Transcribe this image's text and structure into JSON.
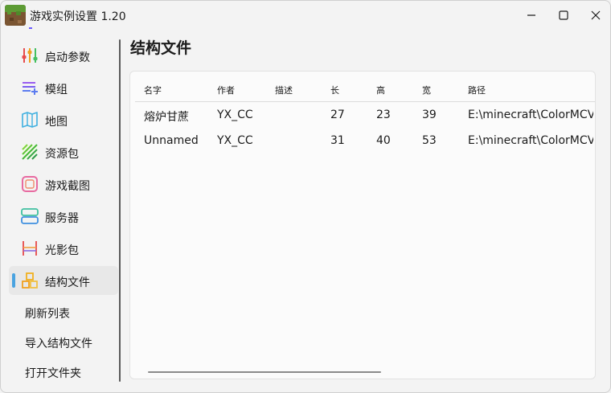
{
  "window": {
    "title": "游戏实例设置 1.20"
  },
  "sidebar": {
    "items": [
      {
        "label": "启动参数",
        "icon": "sliders-icon",
        "active": false
      },
      {
        "label": "模组",
        "icon": "mod-list-icon",
        "active": false
      },
      {
        "label": "地图",
        "icon": "map-icon",
        "active": false
      },
      {
        "label": "资源包",
        "icon": "resource-pack-icon",
        "active": false
      },
      {
        "label": "游戏截图",
        "icon": "screenshot-icon",
        "active": false
      },
      {
        "label": "服务器",
        "icon": "server-icon",
        "active": false
      },
      {
        "label": "光影包",
        "icon": "shader-pack-icon",
        "active": false
      },
      {
        "label": "结构文件",
        "icon": "structure-icon",
        "active": true
      }
    ],
    "actions": [
      {
        "label": "刷新列表"
      },
      {
        "label": "导入结构文件"
      },
      {
        "label": "打开文件夹"
      }
    ]
  },
  "main": {
    "title": "结构文件",
    "table": {
      "columns": [
        "名字",
        "作者",
        "描述",
        "长",
        "高",
        "宽",
        "路径"
      ],
      "rows": [
        [
          "熔炉甘蔗",
          "YX_CC",
          "",
          "27",
          "23",
          "39",
          "E:\\minecraft\\ColorMCV"
        ],
        [
          "Unnamed",
          "YX_CC",
          "",
          "31",
          "40",
          "53",
          "E:\\minecraft\\ColorMCV"
        ]
      ]
    }
  },
  "colors": {
    "accent": "#4aa3e0",
    "window_bg": "#f3f3f3",
    "card_bg": "#fbfbfb",
    "active_item_bg": "#e8e8e8"
  }
}
